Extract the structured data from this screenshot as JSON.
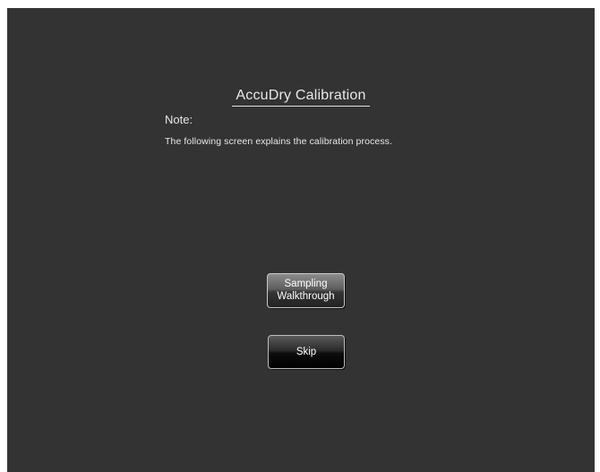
{
  "screen": {
    "title": "AccuDry Calibration",
    "note_label": "Note:",
    "note_text": "The following screen explains the calibration process."
  },
  "buttons": {
    "sampling_line1": "Sampling",
    "sampling_line2": "Walkthrough",
    "skip": "Skip"
  },
  "colors": {
    "background": "#333333",
    "text": "#e8e8e8"
  }
}
